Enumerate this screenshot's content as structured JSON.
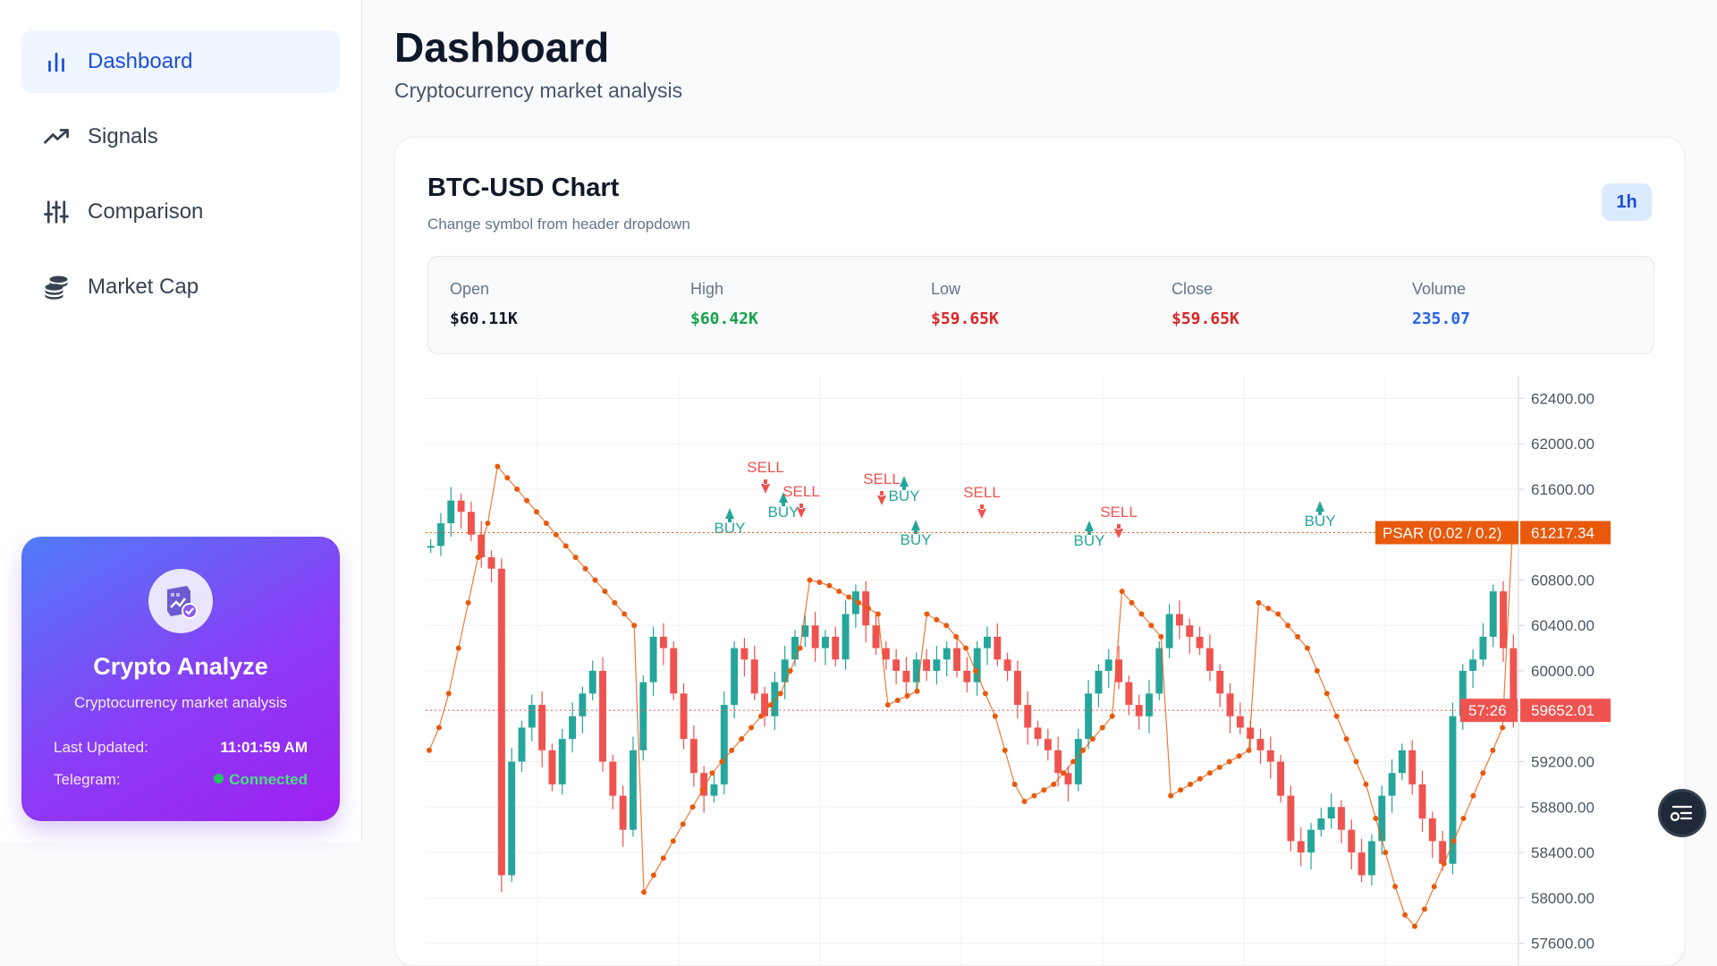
{
  "sidebar": {
    "items": [
      {
        "label": "Dashboard",
        "icon": "bar-chart-icon",
        "active": true
      },
      {
        "label": "Signals",
        "icon": "trending-up-icon"
      },
      {
        "label": "Comparison",
        "icon": "sliders-icon"
      },
      {
        "label": "Market Cap",
        "icon": "coins-icon"
      }
    ],
    "brand": {
      "title": "Crypto Analyze",
      "subtitle": "Cryptocurrency market analysis",
      "last_updated_label": "Last Updated:",
      "last_updated_value": "11:01:59 AM",
      "telegram_label": "Telegram:",
      "telegram_value": "Connected"
    }
  },
  "header": {
    "title": "Dashboard",
    "subtitle": "Cryptocurrency market analysis"
  },
  "card": {
    "title": "BTC-USD Chart",
    "subtitle": "Change symbol from header dropdown",
    "timeframe": "1h",
    "ohlc": [
      {
        "label": "Open",
        "value": "$60.11K",
        "color": "#111827"
      },
      {
        "label": "High",
        "value": "$60.42K",
        "color": "#16a34a"
      },
      {
        "label": "Low",
        "value": "$59.65K",
        "color": "#dc2626"
      },
      {
        "label": "Close",
        "value": "$59.65K",
        "color": "#dc2626"
      },
      {
        "label": "Volume",
        "value": "235.07",
        "color": "#2563eb"
      }
    ]
  },
  "colors": {
    "up": "#26a69a",
    "down": "#ef5350",
    "psar": "#e8590c",
    "accent": "#1d4ed8"
  },
  "chart_data": {
    "type": "candlestick",
    "symbol": "BTC-USD",
    "ylim": [
      57400,
      62600
    ],
    "y_ticks": [
      "62400.00",
      "62000.00",
      "61600.00",
      "61200.00",
      "60800.00",
      "60400.00",
      "60000.00",
      "59600.00",
      "59200.00",
      "58800.00",
      "58400.00",
      "58000.00",
      "57600.00"
    ],
    "psar_label": "PSAR (0.02 / 0.2)",
    "psar_value": "61217.34",
    "price_countdown": "57:26",
    "price_value": "59652.01",
    "close_series": [
      61100,
      61300,
      61500,
      61400,
      61200,
      61000,
      60900,
      58200,
      59200,
      59500,
      59700,
      59300,
      59000,
      59400,
      59600,
      59800,
      60000,
      59200,
      58900,
      58600,
      59300,
      59900,
      60300,
      60200,
      59800,
      59400,
      59100,
      58900,
      59000,
      59700,
      60200,
      60100,
      59800,
      59600,
      59900,
      60100,
      60300,
      60400,
      60200,
      60300,
      60100,
      60500,
      60700,
      60400,
      60200,
      60100,
      60000,
      59900,
      60100,
      60000,
      60100,
      60200,
      60000,
      59900,
      60200,
      60300,
      60100,
      60000,
      59700,
      59500,
      59400,
      59300,
      59100,
      59000,
      59400,
      59800,
      60000,
      60100,
      59900,
      59700,
      59600,
      59800,
      60200,
      60500,
      60400,
      60300,
      60200,
      60000,
      59800,
      59600,
      59500,
      59400,
      59300,
      59200,
      58900,
      58500,
      58400,
      58600,
      58700,
      58800,
      58600,
      58400,
      58200,
      58500,
      58900,
      59100,
      59300,
      59000,
      58700,
      58500,
      58300,
      59600,
      60000,
      60100,
      60300,
      60700,
      60200,
      59650
    ],
    "psar_series": [
      59300,
      59500,
      59800,
      60200,
      60600,
      61000,
      61300,
      61800,
      61700,
      61600,
      61500,
      61400,
      61300,
      61200,
      61100,
      61000,
      60900,
      60800,
      60700,
      60600,
      60500,
      60400,
      58050,
      58200,
      58350,
      58500,
      58650,
      58800,
      58950,
      59100,
      59200,
      59300,
      59400,
      59500,
      59600,
      59700,
      59800,
      60000,
      60200,
      60800,
      60780,
      60750,
      60700,
      60650,
      60600,
      60550,
      60500,
      59700,
      59740,
      59780,
      59820,
      60500,
      60450,
      60400,
      60300,
      60200,
      60000,
      59800,
      59600,
      59300,
      59000,
      58850,
      58900,
      58950,
      59000,
      59100,
      59200,
      59300,
      59400,
      59500,
      59600,
      60700,
      60600,
      60500,
      60400,
      60300,
      58900,
      58950,
      59000,
      59050,
      59100,
      59150,
      59200,
      59250,
      59300,
      60600,
      60550,
      60500,
      60400,
      60300,
      60200,
      60000,
      59800,
      59600,
      59400,
      59200,
      59000,
      58700,
      58400,
      58100,
      57850,
      57750,
      57900,
      58100,
      58300,
      58500,
      58700,
      58900,
      59100,
      59300,
      59500,
      61200
    ]
  },
  "signals": [
    {
      "type": "SELL",
      "text": "SELL"
    },
    {
      "type": "BUY",
      "text": "BUY"
    },
    {
      "type": "BUY",
      "text": "BUY"
    },
    {
      "type": "SELL",
      "text": "SELL"
    },
    {
      "type": "SELL",
      "text": "SELL"
    },
    {
      "type": "BUY",
      "text": "BUY"
    },
    {
      "type": "SELL",
      "text": "SELL"
    },
    {
      "type": "BUY",
      "text": "BUY"
    },
    {
      "type": "SELL",
      "text": "SELL"
    },
    {
      "type": "BUY",
      "text": "BUY"
    },
    {
      "type": "BUY",
      "text": "BUY"
    }
  ]
}
